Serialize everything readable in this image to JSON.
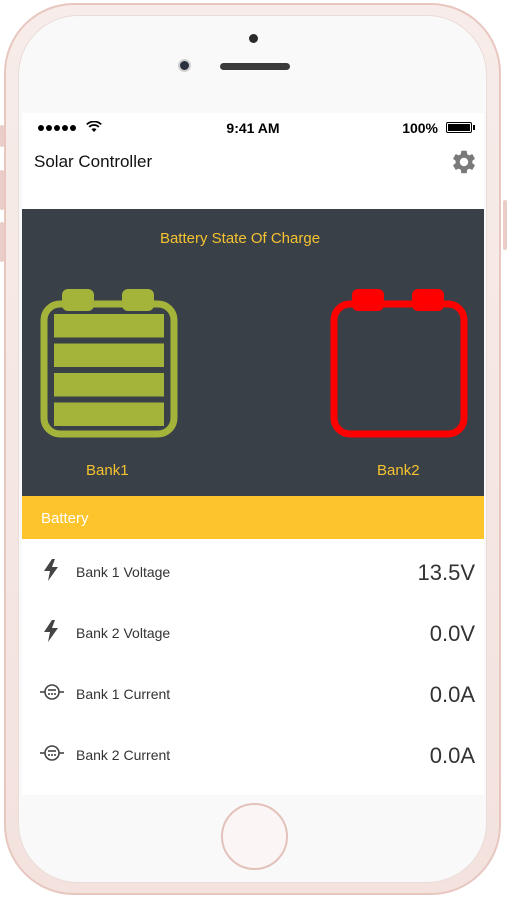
{
  "status_bar": {
    "time": "9:41 AM",
    "battery_percent": "100%"
  },
  "header": {
    "title": "Solar Controller",
    "settings_icon": "gear-icon"
  },
  "soc_panel": {
    "title": "Battery State Of Charge",
    "banks": [
      {
        "label": "Bank1",
        "color": "#a4b33a",
        "charge_level": 1.0
      },
      {
        "label": "Bank2",
        "color": "#ff0000",
        "charge_level": 0.0
      }
    ]
  },
  "section": {
    "title": "Battery",
    "color": "#fdc42b"
  },
  "readings": [
    {
      "icon": "bolt-icon",
      "label": "Bank 1 Voltage",
      "value": "13.5V"
    },
    {
      "icon": "bolt-icon",
      "label": "Bank 2 Voltage",
      "value": "0.0V"
    },
    {
      "icon": "current-icon",
      "label": "Bank 1 Current",
      "value": "0.0A"
    },
    {
      "icon": "current-icon",
      "label": "Bank 2 Current",
      "value": "0.0A"
    }
  ]
}
